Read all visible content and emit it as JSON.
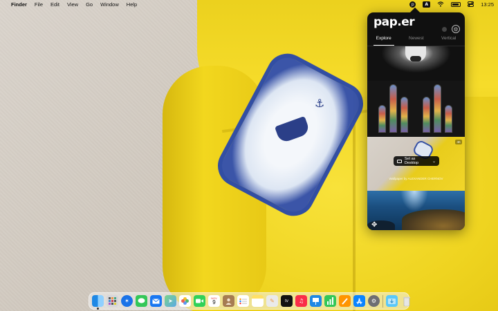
{
  "menubar": {
    "apple": "",
    "app_name": "Finder",
    "menus": [
      "File",
      "Edit",
      "View",
      "Go",
      "Window",
      "Help"
    ],
    "status_icons": [
      "papr-status-icon",
      "input-source-icon",
      "wifi-icon",
      "battery-icon",
      "control-center-icon"
    ],
    "input_source": "A",
    "time": "13:25"
  },
  "popover": {
    "logo": "pap.er",
    "tabs": [
      {
        "label": "Explore",
        "active": true
      },
      {
        "label": "Newest",
        "active": false
      },
      {
        "label": "Vertical",
        "active": false
      }
    ],
    "set_desktop_label": "Set as Desktop",
    "caption": "Wallpaper by ALEXANDER CHERNOV",
    "badge": "4K"
  },
  "dock": {
    "apps": [
      {
        "name": "finder",
        "color": "#1e88e5"
      },
      {
        "name": "launchpad",
        "color": "#8e8e93"
      },
      {
        "name": "safari",
        "color": "#1a73e8"
      },
      {
        "name": "messages",
        "color": "#34c759"
      },
      {
        "name": "mail",
        "color": "#1877f2"
      },
      {
        "name": "maps",
        "color": "#4caf50"
      },
      {
        "name": "photos",
        "color": "#f4b400"
      },
      {
        "name": "facetime",
        "color": "#30d158"
      },
      {
        "name": "calendar",
        "color": "#ffffff"
      },
      {
        "name": "contacts",
        "color": "#a67c52"
      },
      {
        "name": "reminders",
        "color": "#ffffff"
      },
      {
        "name": "notes",
        "color": "#ffe066"
      },
      {
        "name": "freeform",
        "color": "#eaeaea"
      },
      {
        "name": "apple-tv",
        "color": "#111111"
      },
      {
        "name": "music",
        "color": "#fa2d48"
      },
      {
        "name": "keynote",
        "color": "#1e88e5"
      },
      {
        "name": "numbers",
        "color": "#34c759"
      },
      {
        "name": "pages",
        "color": "#ff9500"
      },
      {
        "name": "app-store",
        "color": "#0a84ff"
      },
      {
        "name": "system-settings",
        "color": "#6e6e73"
      },
      {
        "name": "downloads",
        "color": "#5ac8fa"
      },
      {
        "name": "trash",
        "color": "#d8d8d8"
      }
    ],
    "calendar_month": "NOV",
    "calendar_day": "9"
  }
}
